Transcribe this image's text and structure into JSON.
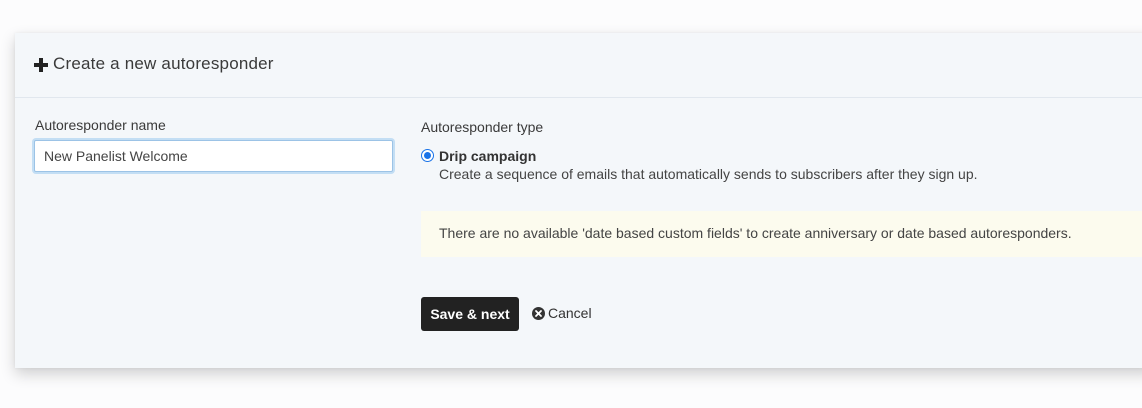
{
  "header": {
    "title": "Create a new autoresponder",
    "icon": "plus-icon"
  },
  "form": {
    "name_label": "Autoresponder name",
    "name_value": "New Panelist Welcome",
    "type_label": "Autoresponder type",
    "type_options": [
      {
        "title": "Drip campaign",
        "description": "Create a sequence of emails that automatically sends to subscribers after they sign up.",
        "selected": true
      }
    ],
    "notice": "There are no available 'date based custom fields' to create anniversary or date based autoresponders."
  },
  "actions": {
    "save_label": "Save & next",
    "cancel_label": "Cancel",
    "cancel_icon": "times-circle-icon"
  },
  "colors": {
    "accent": "#1a73e8",
    "button_bg": "#222222",
    "notice_bg": "#fcfbee",
    "panel_bg": "#f4f7fa"
  }
}
